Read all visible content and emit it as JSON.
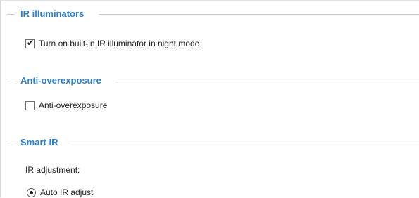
{
  "sections": [
    {
      "title": "IR illuminators",
      "options": [
        {
          "label": "Turn on built-in IR illuminator in night mode",
          "checked": true
        }
      ]
    },
    {
      "title": "Anti-overexposure",
      "options": [
        {
          "label": "Anti-overexposure",
          "checked": false
        }
      ]
    },
    {
      "title": "Smart IR",
      "field_label": "IR adjustment:",
      "radio_options": [
        {
          "label": "Auto IR adjust",
          "selected": true
        }
      ]
    }
  ],
  "glyphs": {
    "check": "✔"
  },
  "colors": {
    "section_title": "#2f7fc5",
    "rule": "#cfcfcf"
  }
}
